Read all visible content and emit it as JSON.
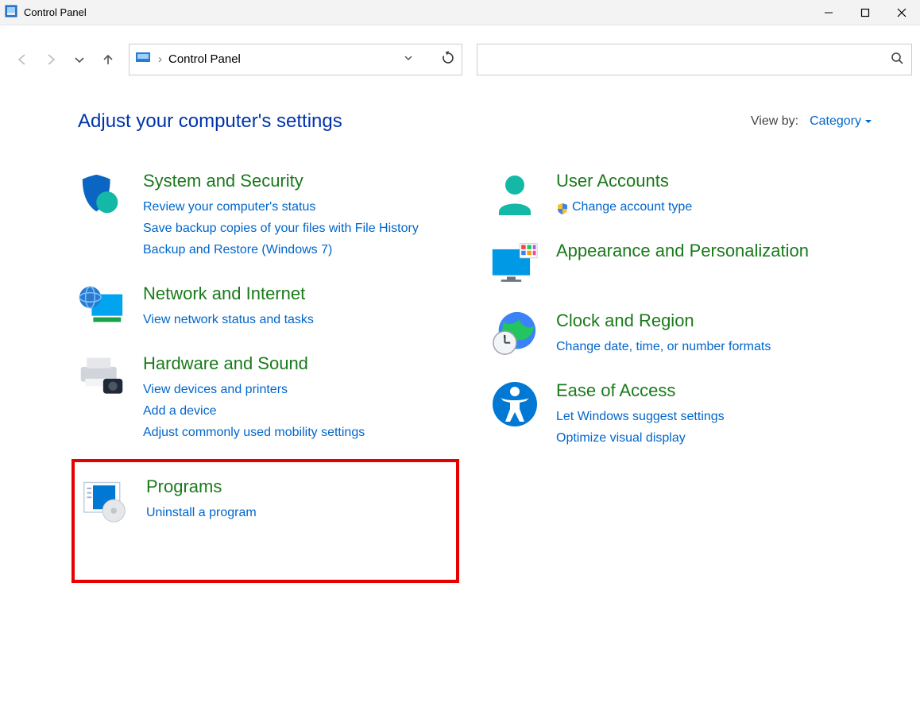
{
  "window": {
    "title": "Control Panel"
  },
  "address": {
    "path": "Control Panel"
  },
  "search": {
    "placeholder": "",
    "value": ""
  },
  "heading": "Adjust your computer's settings",
  "viewby": {
    "label": "View by:",
    "value": "Category"
  },
  "left": [
    {
      "title": "System and Security",
      "links": [
        "Review your computer's status",
        "Save backup copies of your files with File History",
        "Backup and Restore (Windows 7)"
      ]
    },
    {
      "title": "Network and Internet",
      "links": [
        "View network status and tasks"
      ]
    },
    {
      "title": "Hardware and Sound",
      "links": [
        "View devices and printers",
        "Add a device",
        "Adjust commonly used mobility settings"
      ]
    },
    {
      "title": "Programs",
      "links": [
        "Uninstall a program"
      ]
    }
  ],
  "right": [
    {
      "title": "User Accounts",
      "links": [
        "Change account type"
      ],
      "shielded": [
        true
      ]
    },
    {
      "title": "Appearance and Personalization",
      "links": []
    },
    {
      "title": "Clock and Region",
      "links": [
        "Change date, time, or number formats"
      ]
    },
    {
      "title": "Ease of Access",
      "links": [
        "Let Windows suggest settings",
        "Optimize visual display"
      ]
    }
  ]
}
